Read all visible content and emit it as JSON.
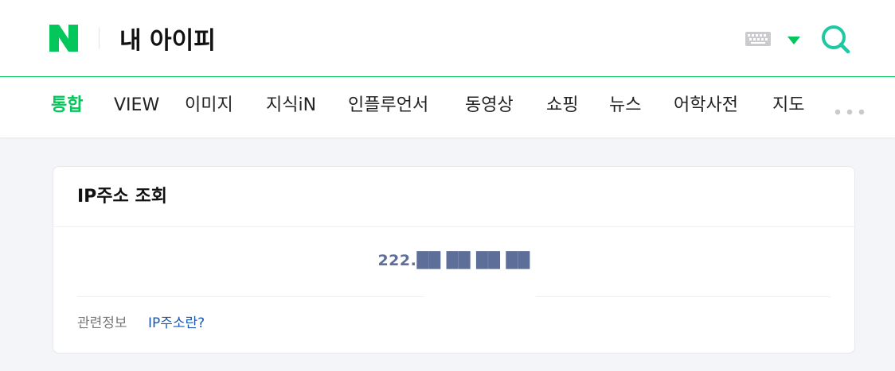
{
  "header": {
    "logo_text": "N",
    "query": "내 아이피",
    "icons": {
      "keyboard": "keyboard-icon",
      "dropdown": "chevron-down-icon",
      "search": "search-icon"
    },
    "brand_color": "#03c75a"
  },
  "tabs": {
    "items": [
      {
        "label": "통합",
        "active": true
      },
      {
        "label": "VIEW",
        "active": false
      },
      {
        "label": "이미지",
        "active": false
      },
      {
        "label": "지식iN",
        "active": false
      },
      {
        "label": "인플루언서",
        "active": false
      },
      {
        "label": "동영상",
        "active": false
      },
      {
        "label": "쇼핑",
        "active": false
      },
      {
        "label": "뉴스",
        "active": false
      },
      {
        "label": "어학사전",
        "active": false
      },
      {
        "label": "지도",
        "active": false
      }
    ],
    "more_icon": "more-dots-icon"
  },
  "card": {
    "title": "IP주소 조회",
    "ip_address": "222.██ ██ ██ ██",
    "related_label": "관련정보",
    "related_link": "IP주소란?"
  }
}
